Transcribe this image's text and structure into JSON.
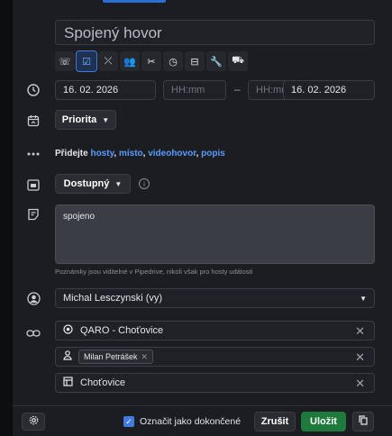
{
  "title_value": "Spojený hovor",
  "activity_types": [
    {
      "icon": "phone-icon",
      "glyph": "☏",
      "selected": false
    },
    {
      "icon": "task-icon",
      "glyph": "☑",
      "selected": true
    },
    {
      "icon": "deadline-icon",
      "glyph": "⤫",
      "selected": false
    },
    {
      "icon": "meeting-icon",
      "glyph": "👥",
      "selected": false
    },
    {
      "icon": "tools-icon",
      "glyph": "✂",
      "selected": false
    },
    {
      "icon": "clock-icon",
      "glyph": "◷",
      "selected": false
    },
    {
      "icon": "car-icon",
      "glyph": "⊟",
      "selected": false
    },
    {
      "icon": "wrench-icon",
      "glyph": "🔧",
      "selected": false
    },
    {
      "icon": "truck-icon",
      "glyph": "⛟",
      "selected": false
    }
  ],
  "date_start": "16. 02. 2026",
  "time_start_placeholder": "HH:mm",
  "dash": "–",
  "time_end_placeholder": "HH:mm",
  "date_end": "16. 02. 2026",
  "priority_label": "Priorita",
  "add_more": {
    "prefix": "Přidejte ",
    "guests": "hosty",
    "place": "místo",
    "video": "videohovor",
    "description": "popis",
    "sep": ", "
  },
  "availability_label": "Dostupný",
  "info_glyph": "i",
  "notes_text": "spojeno",
  "notes_hint": "Poznámky jsou viditelné v Pipedrive, nikoli však pro hosty události",
  "owner_label": "Michal Lesczynski (vy)",
  "organization_label": "QARO - Choťovice",
  "person_chip": "Milan Petrášek",
  "deal_label": "Choťovice",
  "mark_done_label": "Označit jako dokončené",
  "cancel_label": "Zrušit",
  "save_label": "Uložit",
  "colors": {
    "accent": "#3f7be0",
    "save": "#1d7a3c",
    "link": "#5a9bff"
  }
}
